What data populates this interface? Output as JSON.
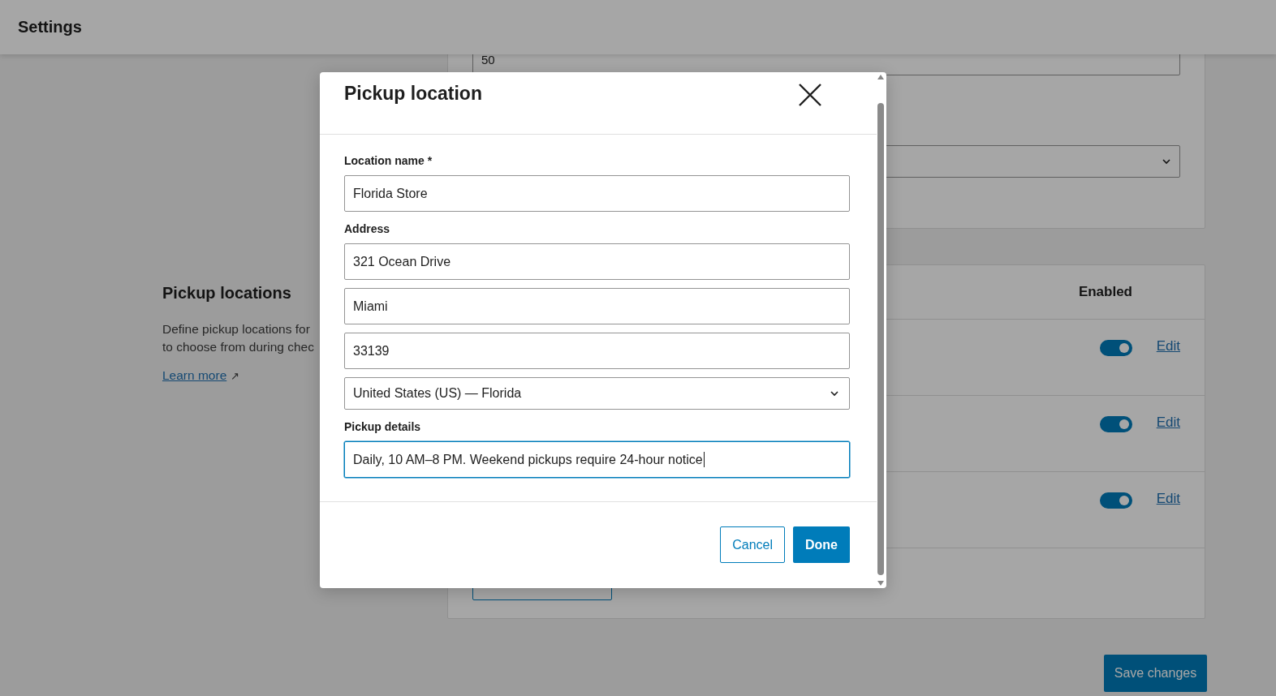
{
  "header": {
    "title": "Settings"
  },
  "general_card": {
    "quantity_value": "50"
  },
  "pickup_section": {
    "title": "Pickup locations",
    "description_lines": [
      "Define pickup locations for",
      "to choose from during chec"
    ],
    "learn_more": "Learn more",
    "learn_more_icon": "↗"
  },
  "locations_table": {
    "enabled_heading": "Enabled",
    "rows": [
      {
        "enabled": true,
        "action": "Edit"
      },
      {
        "enabled": true,
        "action": "Edit"
      },
      {
        "enabled": true,
        "action": "Edit"
      }
    ]
  },
  "save_button": "Save changes",
  "dialog": {
    "title": "Pickup location",
    "groups": [
      {
        "label": "Location name *",
        "fields": [
          {
            "kind": "text",
            "value": "Florida Store",
            "focused": false
          }
        ]
      },
      {
        "label": "Address",
        "fields": [
          {
            "kind": "text",
            "value": "321 Ocean Drive",
            "focused": false
          },
          {
            "kind": "text",
            "value": "Miami",
            "focused": false
          },
          {
            "kind": "text",
            "value": "33139",
            "focused": false
          },
          {
            "kind": "select",
            "value": "United States (US) — Florida",
            "focused": false
          }
        ]
      },
      {
        "label": "Pickup details",
        "fields": [
          {
            "kind": "text",
            "value": "Daily, 10 AM–8 PM. Weekend pickups require 24-hour notice",
            "focused": true
          }
        ]
      }
    ],
    "buttons": [
      {
        "kind": "secondary",
        "label": "Cancel"
      },
      {
        "kind": "primary",
        "label": "Done"
      }
    ]
  }
}
